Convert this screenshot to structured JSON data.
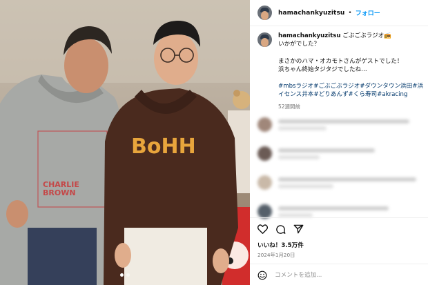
{
  "header": {
    "username": "hamachankyuzitsu",
    "separator": "•",
    "follow_label": "フォロー"
  },
  "caption": {
    "username": "hamachankyuzitsu",
    "line1": "ごぶごぶラジオ📻",
    "line2": "いかがでした？",
    "line3": "まさかのハマ・オカモトさんがゲストでした！",
    "line4": "浜ちゃん終始タジタジでしたね…",
    "hashtags_line1": "#mbsラジオ#ごぶごぶラジオ#ダウンタウン浜田#浜",
    "hashtags_line2": "イセンス井本#どりあんず#くら寿司#akracing",
    "time_ago": "52週間前"
  },
  "photo": {
    "hoodie_left_print_top": "CHARLIE",
    "hoodie_left_print_bottom": "BROWN",
    "hoodie_right_text": "BoHH"
  },
  "post": {
    "likes": "いいね！3.5万件",
    "date": "2024年1月20日"
  },
  "comment_box": {
    "placeholder": "コメントを追加..."
  },
  "icons": {
    "like": "heart-icon",
    "comment": "comment-icon",
    "share": "share-icon",
    "emoji": "emoji-icon"
  },
  "carousel": {
    "slides": 2,
    "active": 1
  }
}
